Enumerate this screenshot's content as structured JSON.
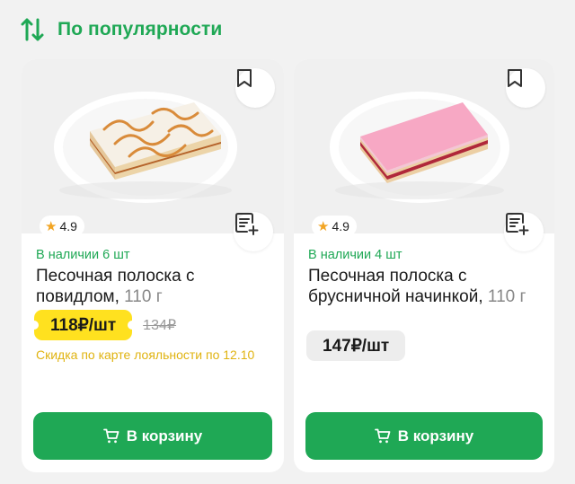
{
  "sort": {
    "label": "По популярности",
    "icon": "sort-arrows-icon"
  },
  "colors": {
    "accent": "#1fa855",
    "sale_badge": "#ffe11f",
    "discount_text": "#e0b310",
    "star": "#f2a524"
  },
  "products": [
    {
      "rating": "4.9",
      "stock": "В наличии 6 шт",
      "name": "Песочная полоска с повидлом,",
      "weight": "110 г",
      "price": "118₽/шт",
      "old_price": "134₽",
      "discount_note": "Скидка по карте лояльности по 12.10",
      "cart_label": "В корзину",
      "image": "cake-with-caramel-glaze"
    },
    {
      "rating": "4.9",
      "stock": "В наличии 4 шт",
      "name": "Песочная полоска с брусничной начинкой,",
      "weight": "110 г",
      "price": "147₽/шт",
      "cart_label": "В корзину",
      "image": "cake-with-pink-glaze"
    }
  ]
}
